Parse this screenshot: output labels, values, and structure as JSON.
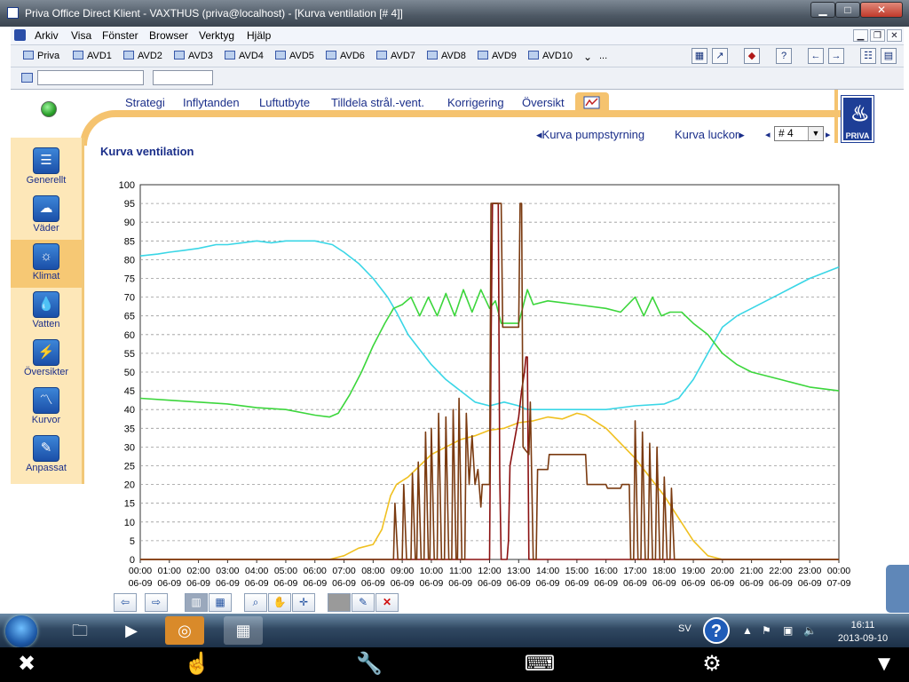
{
  "window": {
    "title": "Priva Office Direct Klient - VAXTHUS (priva@localhost) - [Kurva ventilation [# 4]]",
    "min_label": "▁",
    "max_label": "□",
    "close_label": "✕"
  },
  "menu": [
    "Arkiv",
    "Visa",
    "Fönster",
    "Browser",
    "Verktyg",
    "Hjälp"
  ],
  "toolbar": {
    "items": [
      "Priva",
      "AVD1",
      "AVD2",
      "AVD3",
      "AVD4",
      "AVD5",
      "AVD6",
      "AVD7",
      "AVD8",
      "AVD9",
      "AVD10",
      "..."
    ]
  },
  "inputs": {
    "field1": "",
    "field2": ""
  },
  "tabs": [
    "Strategi",
    "Inflytanden",
    "Luftutbyte",
    "Tilldela strål.-vent.",
    "Korrigering",
    "Översikt"
  ],
  "nav": {
    "prev_link": "Kurva pumpstyrning",
    "next_link": "Kurva luckor",
    "selector_value": "# 4"
  },
  "logo_text": "PRIVA",
  "sidebar": [
    {
      "label": "Generellt",
      "icon": "document-icon"
    },
    {
      "label": "Väder",
      "icon": "weather-icon"
    },
    {
      "label": "Klimat",
      "icon": "sun-icon"
    },
    {
      "label": "Vatten",
      "icon": "water-drop-icon"
    },
    {
      "label": "Översikter",
      "icon": "overview-icon"
    },
    {
      "label": "Kurvor",
      "icon": "curve-icon"
    },
    {
      "label": "Anpassat",
      "icon": "pencil-icon"
    }
  ],
  "page_title": "Kurva ventilation",
  "chart_data": {
    "type": "line",
    "title": "",
    "ylim": [
      0,
      100
    ],
    "yticks": [
      0,
      5,
      10,
      15,
      20,
      25,
      30,
      35,
      40,
      45,
      50,
      55,
      60,
      65,
      70,
      75,
      80,
      85,
      90,
      95,
      100
    ],
    "xlim": [
      0,
      24
    ],
    "xtick_labels": [
      [
        "00:00",
        "06-09"
      ],
      [
        "01:00",
        "06-09"
      ],
      [
        "02:00",
        "06-09"
      ],
      [
        "03:00",
        "06-09"
      ],
      [
        "04:00",
        "06-09"
      ],
      [
        "05:00",
        "06-09"
      ],
      [
        "06:00",
        "06-09"
      ],
      [
        "07:00",
        "06-09"
      ],
      [
        "08:00",
        "06-09"
      ],
      [
        "09:00",
        "06-09"
      ],
      [
        "10:00",
        "06-09"
      ],
      [
        "11:00",
        "06-09"
      ],
      [
        "12:00",
        "06-09"
      ],
      [
        "13:00",
        "06-09"
      ],
      [
        "14:00",
        "06-09"
      ],
      [
        "15:00",
        "06-09"
      ],
      [
        "16:00",
        "06-09"
      ],
      [
        "17:00",
        "06-09"
      ],
      [
        "18:00",
        "06-09"
      ],
      [
        "19:00",
        "06-09"
      ],
      [
        "20:00",
        "06-09"
      ],
      [
        "21:00",
        "06-09"
      ],
      [
        "22:00",
        "06-09"
      ],
      [
        "23:00",
        "06-09"
      ],
      [
        "00:00",
        "07-09"
      ]
    ],
    "grid": true,
    "series": [
      {
        "color": "#3ad6e6",
        "points": [
          [
            0,
            81
          ],
          [
            0.6,
            81.5
          ],
          [
            1,
            82
          ],
          [
            1.5,
            82.5
          ],
          [
            2,
            83
          ],
          [
            2.6,
            84
          ],
          [
            3,
            84
          ],
          [
            3.5,
            84.5
          ],
          [
            4,
            85
          ],
          [
            4.5,
            84.5
          ],
          [
            5,
            85
          ],
          [
            6,
            85
          ],
          [
            6.6,
            84
          ],
          [
            7,
            82
          ],
          [
            7.5,
            79
          ],
          [
            8,
            75
          ],
          [
            8.5,
            70
          ],
          [
            8.8,
            66
          ],
          [
            9.2,
            60
          ],
          [
            9.6,
            56
          ],
          [
            10,
            52
          ],
          [
            10.5,
            48
          ],
          [
            11,
            45
          ],
          [
            11.5,
            42
          ],
          [
            12,
            41
          ],
          [
            12.5,
            42
          ],
          [
            13,
            41
          ],
          [
            13.3,
            40
          ],
          [
            14,
            40
          ],
          [
            15,
            40
          ],
          [
            16,
            40
          ],
          [
            17,
            41
          ],
          [
            18,
            41.5
          ],
          [
            18.5,
            43
          ],
          [
            19,
            48
          ],
          [
            19.5,
            55
          ],
          [
            20,
            62
          ],
          [
            20.5,
            65
          ],
          [
            21,
            67
          ],
          [
            22,
            71
          ],
          [
            23,
            75
          ],
          [
            24,
            78
          ]
        ]
      },
      {
        "color": "#3cd63c",
        "points": [
          [
            0,
            43
          ],
          [
            1,
            42.5
          ],
          [
            2,
            42
          ],
          [
            3,
            41.5
          ],
          [
            4,
            40.5
          ],
          [
            5,
            40
          ],
          [
            6,
            38.5
          ],
          [
            6.5,
            38
          ],
          [
            6.8,
            39
          ],
          [
            7.2,
            44
          ],
          [
            7.6,
            50
          ],
          [
            8,
            57
          ],
          [
            8.4,
            63
          ],
          [
            8.7,
            67
          ],
          [
            9,
            68
          ],
          [
            9.3,
            70
          ],
          [
            9.6,
            65
          ],
          [
            9.9,
            70
          ],
          [
            10.2,
            65
          ],
          [
            10.5,
            71
          ],
          [
            10.8,
            65
          ],
          [
            11.1,
            72
          ],
          [
            11.4,
            66
          ],
          [
            11.7,
            72
          ],
          [
            12,
            67
          ],
          [
            12.2,
            69
          ],
          [
            12.4,
            63
          ],
          [
            13,
            63
          ],
          [
            13.3,
            72
          ],
          [
            13.5,
            68
          ],
          [
            14,
            69
          ],
          [
            15,
            68
          ],
          [
            16,
            67
          ],
          [
            16.5,
            66
          ],
          [
            17,
            70
          ],
          [
            17.3,
            65
          ],
          [
            17.6,
            70
          ],
          [
            17.9,
            65
          ],
          [
            18.2,
            66
          ],
          [
            18.6,
            66
          ],
          [
            19,
            63
          ],
          [
            19.5,
            60
          ],
          [
            20,
            55
          ],
          [
            20.5,
            52
          ],
          [
            21,
            50
          ],
          [
            22,
            48
          ],
          [
            23,
            46
          ],
          [
            24,
            45
          ]
        ]
      },
      {
        "color": "#f0c020",
        "points": [
          [
            0,
            0
          ],
          [
            6.5,
            0
          ],
          [
            7,
            1
          ],
          [
            7.5,
            3
          ],
          [
            8,
            4
          ],
          [
            8.3,
            8
          ],
          [
            8.6,
            17
          ],
          [
            8.8,
            20
          ],
          [
            9.2,
            22
          ],
          [
            9.6,
            25
          ],
          [
            10,
            28
          ],
          [
            10.5,
            30
          ],
          [
            11,
            32
          ],
          [
            11.5,
            33
          ],
          [
            12,
            34.5
          ],
          [
            12.5,
            35
          ],
          [
            13,
            36.5
          ],
          [
            13.5,
            37
          ],
          [
            14,
            38
          ],
          [
            14.5,
            37.5
          ],
          [
            15,
            39
          ],
          [
            15.3,
            38.5
          ],
          [
            15.6,
            37
          ],
          [
            16,
            35
          ],
          [
            16.5,
            31
          ],
          [
            17,
            27
          ],
          [
            17.5,
            22
          ],
          [
            18,
            17
          ],
          [
            18.5,
            11
          ],
          [
            19,
            5
          ],
          [
            19.5,
            1
          ],
          [
            20,
            0
          ],
          [
            24,
            0
          ]
        ]
      },
      {
        "color": "#8a1010",
        "points": [
          [
            0,
            0
          ],
          [
            12,
            0
          ],
          [
            12.05,
            55
          ],
          [
            12.1,
            95
          ],
          [
            12.2,
            95
          ],
          [
            12.3,
            95
          ],
          [
            12.35,
            22
          ],
          [
            12.4,
            0
          ],
          [
            12.6,
            0
          ],
          [
            12.65,
            5
          ],
          [
            12.7,
            25
          ],
          [
            13,
            38
          ],
          [
            13.1,
            45
          ],
          [
            13.2,
            50
          ],
          [
            13.25,
            54
          ],
          [
            13.3,
            54
          ],
          [
            13.35,
            0
          ],
          [
            24,
            0
          ]
        ]
      },
      {
        "color": "#7a3a10",
        "points": [
          [
            0,
            0
          ],
          [
            8.7,
            0
          ],
          [
            8.75,
            15
          ],
          [
            8.85,
            0
          ],
          [
            9.0,
            0
          ],
          [
            9.05,
            20
          ],
          [
            9.15,
            0
          ],
          [
            9.3,
            0
          ],
          [
            9.35,
            23
          ],
          [
            9.45,
            0
          ],
          [
            9.5,
            0
          ],
          [
            9.55,
            26
          ],
          [
            9.65,
            0
          ],
          [
            9.75,
            0
          ],
          [
            9.8,
            34
          ],
          [
            9.9,
            0
          ],
          [
            9.95,
            0
          ],
          [
            10.0,
            35
          ],
          [
            10.1,
            0
          ],
          [
            10.2,
            0
          ],
          [
            10.25,
            39
          ],
          [
            10.35,
            0
          ],
          [
            10.45,
            0
          ],
          [
            10.5,
            38
          ],
          [
            10.6,
            0
          ],
          [
            10.7,
            0
          ],
          [
            10.75,
            40
          ],
          [
            10.85,
            0
          ],
          [
            10.9,
            0
          ],
          [
            10.95,
            43
          ],
          [
            11.05,
            0
          ],
          [
            11.15,
            0
          ],
          [
            11.2,
            39
          ],
          [
            11.3,
            20
          ],
          [
            11.4,
            33
          ],
          [
            11.5,
            20
          ],
          [
            11.6,
            24
          ],
          [
            11.7,
            14
          ],
          [
            11.75,
            20
          ],
          [
            12.0,
            20
          ],
          [
            12.05,
            95
          ],
          [
            12.4,
            95
          ],
          [
            12.45,
            62
          ],
          [
            13.0,
            62
          ],
          [
            13.05,
            95
          ],
          [
            13.1,
            95
          ],
          [
            13.15,
            30
          ],
          [
            13.35,
            28
          ],
          [
            13.4,
            42
          ],
          [
            13.5,
            0
          ],
          [
            13.6,
            0
          ],
          [
            13.65,
            24
          ],
          [
            14.0,
            24
          ],
          [
            14.05,
            28
          ],
          [
            15.3,
            28
          ],
          [
            15.35,
            20
          ],
          [
            16.0,
            20
          ],
          [
            16.05,
            19
          ],
          [
            16.5,
            19
          ],
          [
            16.55,
            20
          ],
          [
            16.8,
            20
          ],
          [
            16.85,
            0
          ],
          [
            16.95,
            0
          ],
          [
            17.0,
            37
          ],
          [
            17.1,
            0
          ],
          [
            17.2,
            0
          ],
          [
            17.25,
            34
          ],
          [
            17.35,
            0
          ],
          [
            17.45,
            0
          ],
          [
            17.5,
            31
          ],
          [
            17.6,
            0
          ],
          [
            17.7,
            0
          ],
          [
            17.75,
            30
          ],
          [
            17.85,
            0
          ],
          [
            17.95,
            0
          ],
          [
            18.0,
            22
          ],
          [
            18.1,
            0
          ],
          [
            18.2,
            0
          ],
          [
            18.25,
            19
          ],
          [
            18.35,
            0
          ],
          [
            24,
            0
          ]
        ]
      }
    ]
  },
  "chart_toolbar": [
    "arrow-left-icon",
    "arrow-right-icon",
    "chart-mode-icon",
    "chart-type-icon",
    "zoom-icon",
    "pan-hand-icon",
    "crosshair-icon",
    "blank-icon",
    "edit-icon",
    "delete-icon"
  ],
  "taskbar": {
    "lang": "SV",
    "time": "16:11",
    "date": "2013-09-10"
  }
}
